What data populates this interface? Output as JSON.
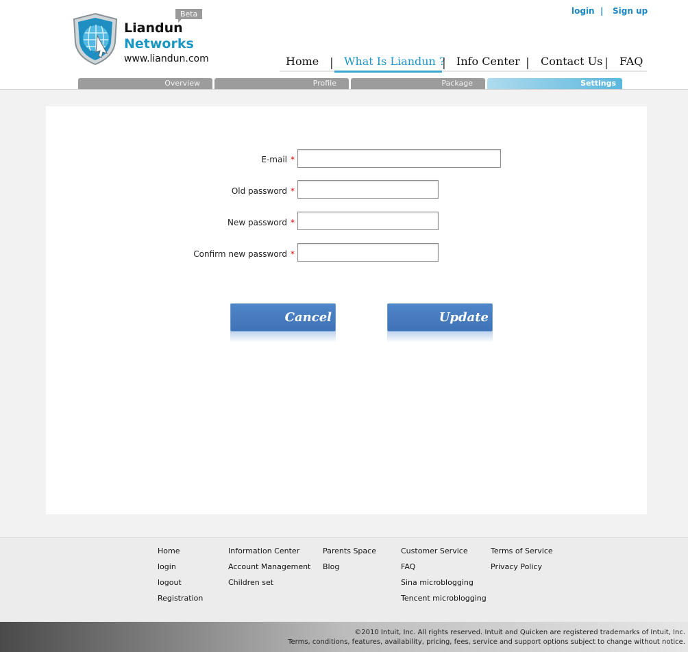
{
  "header": {
    "brand_line1": "Liandun",
    "brand_line2": "Networks",
    "brand_url": "www.liandun.com",
    "beta": "Beta",
    "login": "login",
    "divider": "|",
    "signup": "Sign up",
    "accent": "#1b97c4"
  },
  "nav": {
    "items": [
      "Home",
      "What Is Liandun ?",
      "Info Center",
      "Contact Us",
      "FAQ"
    ],
    "active_index": 1
  },
  "subtabs": {
    "items": [
      "Overview",
      "Profile",
      "Package",
      "Settings"
    ],
    "active_index": 3
  },
  "form": {
    "email_label": "E-mail",
    "old_password_label": "Old password",
    "new_password_label": "New password",
    "confirm_label": "Confirm new password",
    "required_mark": "*",
    "email_value": "",
    "old_password_value": "",
    "new_password_value": "",
    "confirm_value": ""
  },
  "buttons": {
    "cancel": "Cancel",
    "update": "Update",
    "color": "#4a80c4"
  },
  "footer": {
    "col1": [
      "Home",
      "login",
      "logout",
      "Registration"
    ],
    "col2": [
      "Information Center",
      "Account Management",
      "Children set"
    ],
    "col3": [
      "Parents Space",
      "Blog"
    ],
    "col4": [
      "Customer Service",
      "FAQ",
      "Sina microblogging",
      "Tencent microblogging"
    ],
    "col5": [
      "Terms of Service",
      "Privacy Policy"
    ]
  },
  "copyright": {
    "line1": "©2010 Intuit, Inc. All rights reserved. Intuit and Quicken are registered trademarks of Intuit, Inc.",
    "line2": "Terms, conditions, features, availability, pricing, fees, service and support options subject to change without notice."
  }
}
